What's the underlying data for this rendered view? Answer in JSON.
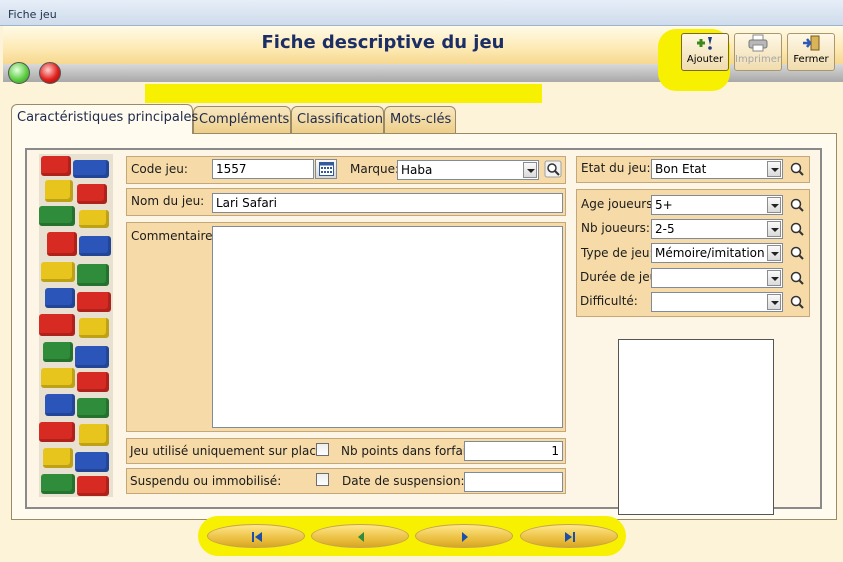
{
  "window": {
    "title": "Fiche jeu"
  },
  "header": {
    "title": "Fiche descriptive du jeu"
  },
  "toolbar": {
    "add_label": "Ajouter",
    "print_label": "Imprimer",
    "close_label": "Fermer"
  },
  "tabs": [
    {
      "label": "Caractéristiques principales",
      "active": true
    },
    {
      "label": "Compléments"
    },
    {
      "label": "Classification"
    },
    {
      "label": "Mots-clés"
    }
  ],
  "form": {
    "code_label": "Code jeu:",
    "code_value": "1557",
    "brand_label": "Marque:",
    "brand_value": "Haba",
    "name_label": "Nom du jeu:",
    "name_value": "Lari Safari",
    "comment_label": "Commentaire:",
    "comment_value": "",
    "onsite_label": "Jeu utilisé uniquement sur place:",
    "points_label": "Nb points dans forfait:",
    "points_value": "1",
    "suspended_label": "Suspendu ou immobilisé:",
    "suspension_date_label": "Date de suspension:",
    "suspension_date_value": ""
  },
  "side": {
    "state_label": "Etat du jeu:",
    "state_value": "Bon Etat",
    "age_label": "Age joueurs:",
    "age_value": "5+",
    "players_label": "Nb joueurs:",
    "players_value": "2-5",
    "type_label": "Type de jeu:",
    "type_value": "Mémoire/imitation",
    "duration_label": "Durée de jeu:",
    "duration_value": "",
    "difficulty_label": "Difficulté:",
    "difficulty_value": ""
  },
  "colors": {
    "highlight": "#f7f000",
    "header_title": "#1b2f66",
    "panel": "#f6dba9"
  }
}
